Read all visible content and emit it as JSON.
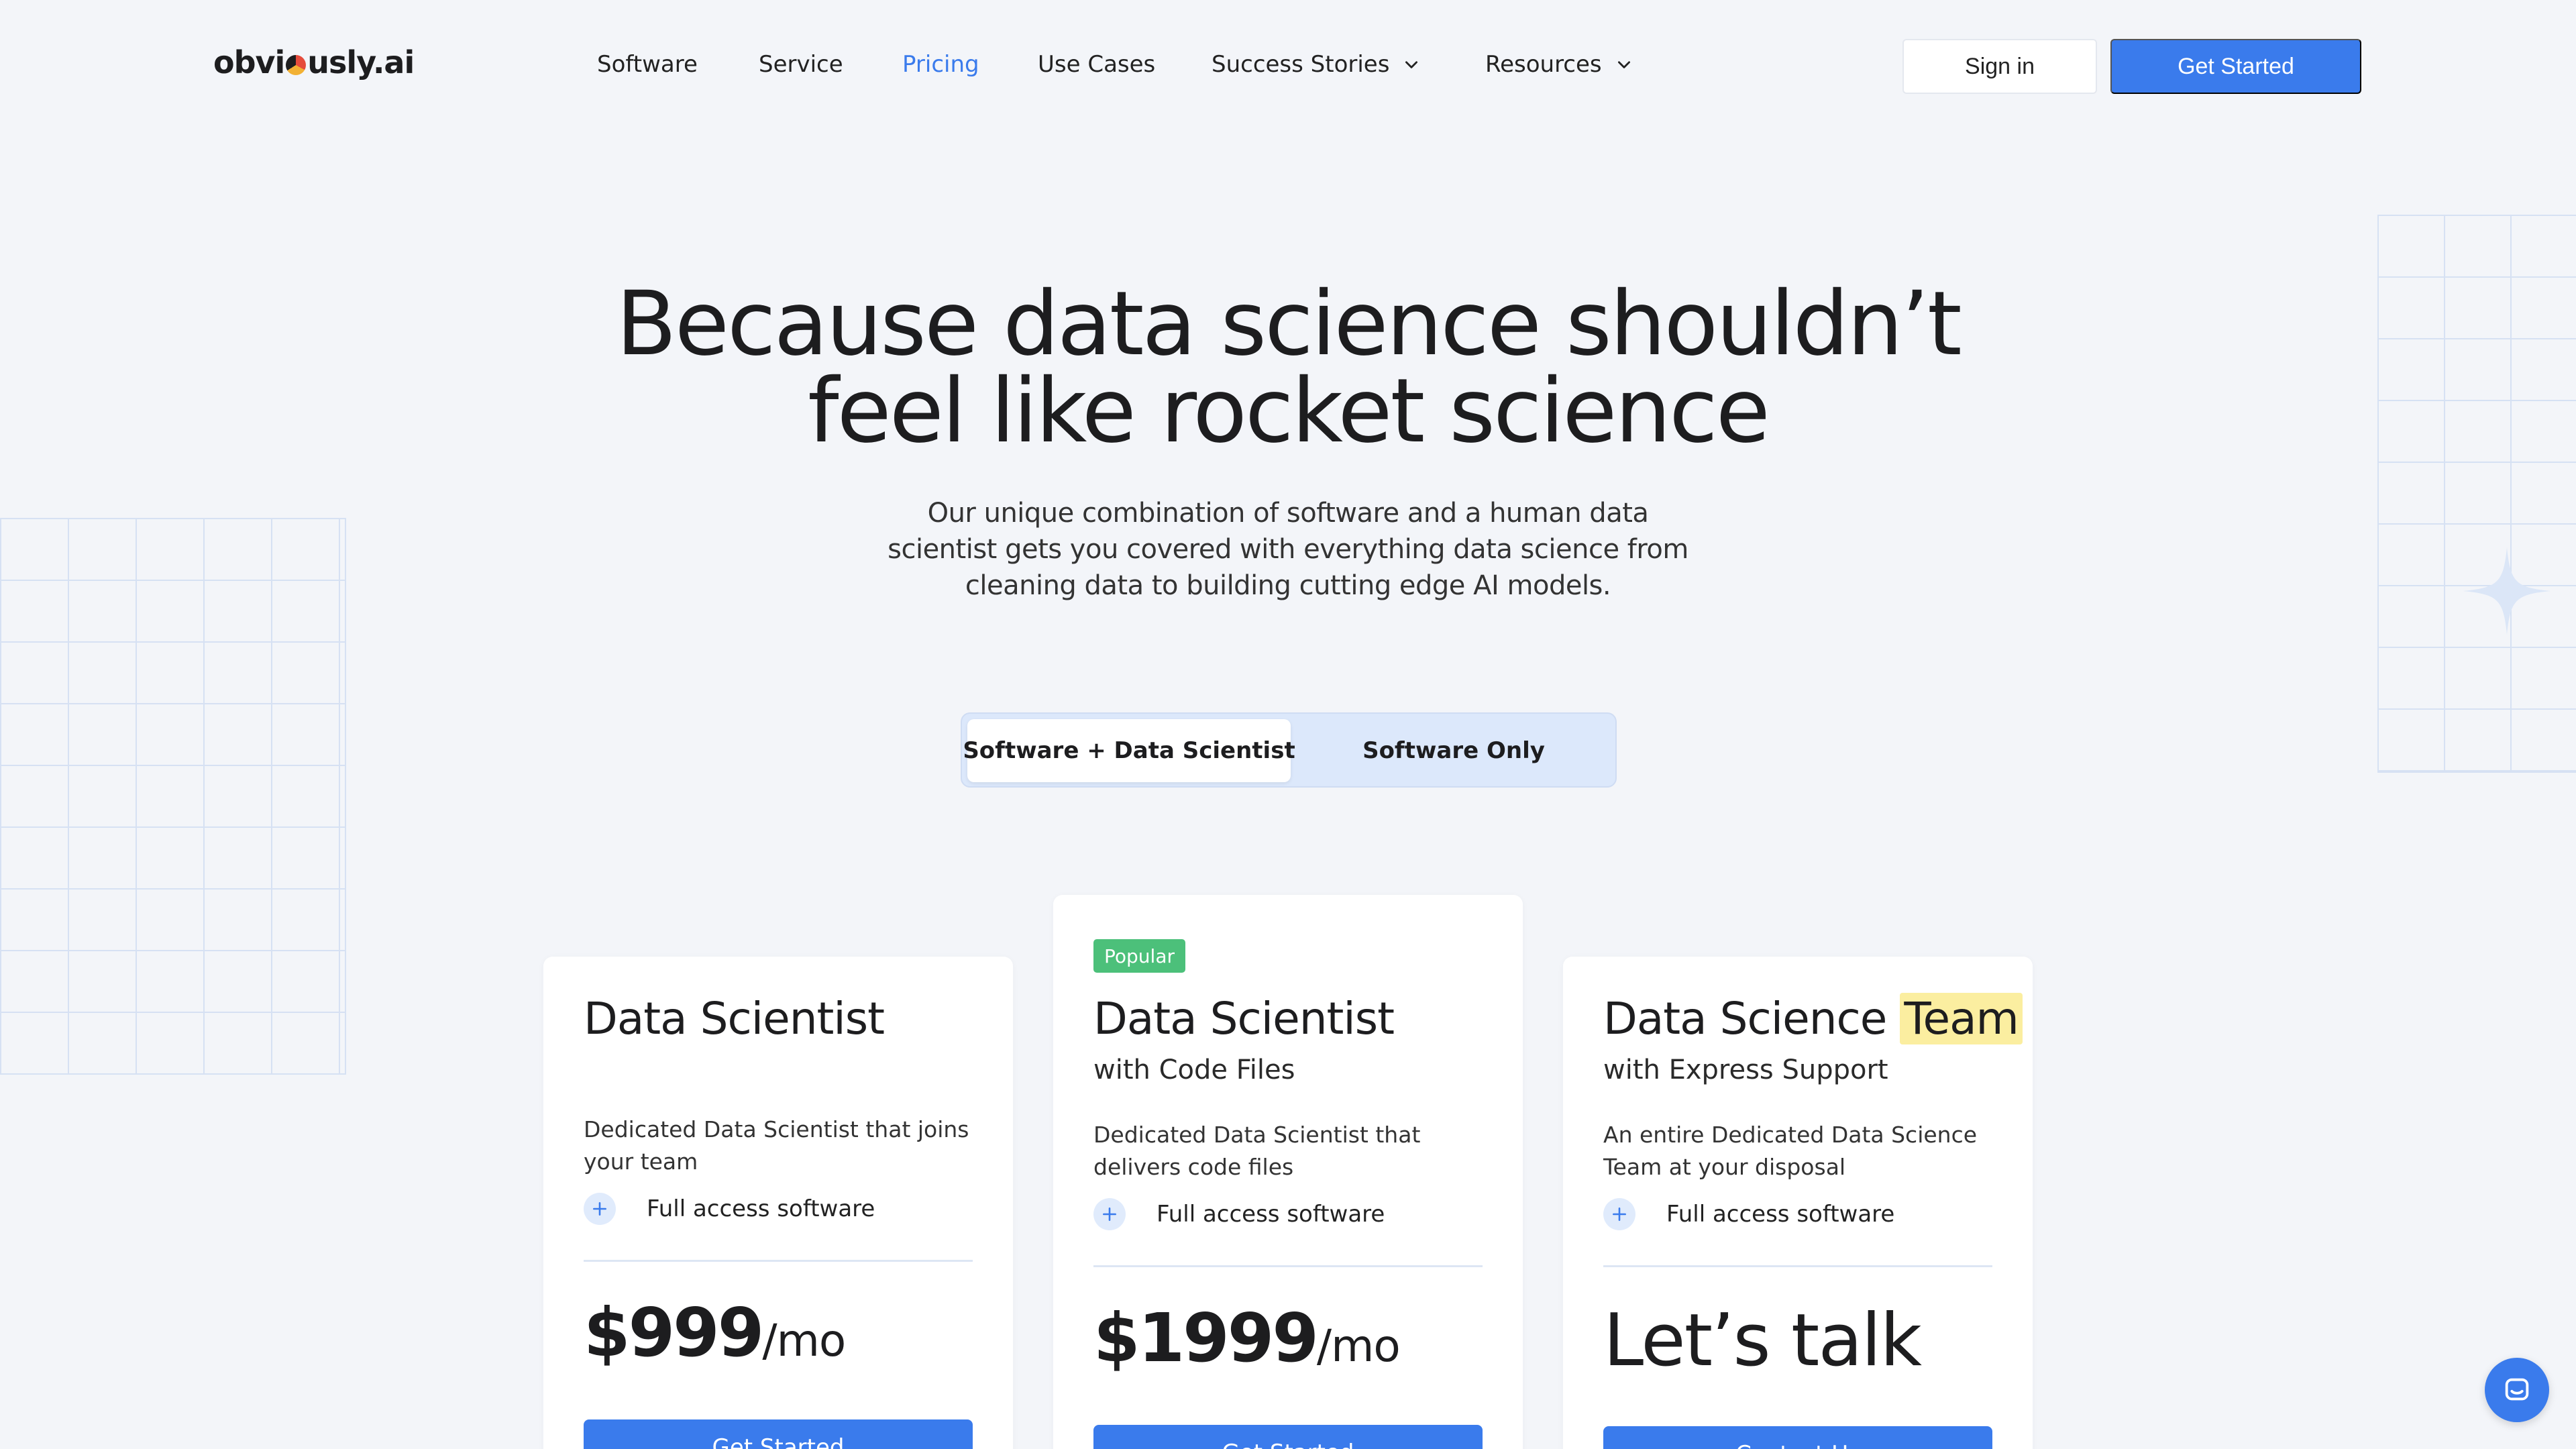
{
  "brand": {
    "logo_text_a": "obvi",
    "logo_text_b": "usly.ai"
  },
  "nav": {
    "links": [
      {
        "label": "Software"
      },
      {
        "label": "Service"
      },
      {
        "label": "Pricing"
      },
      {
        "label": "Use Cases"
      },
      {
        "label": "Success Stories"
      },
      {
        "label": "Resources"
      }
    ],
    "sign_in": "Sign in",
    "get_started": "Get Started"
  },
  "hero": {
    "title_line1": "Because data science shouldn’t",
    "title_line2": "feel like rocket science",
    "subtitle": "Our unique combination of software and a human data scientist gets you covered with everything data science from cleaning data to building cutting edge AI models."
  },
  "toggle": {
    "option_selected": "Software + Data Scientist",
    "option_other": "Software Only"
  },
  "plans": [
    {
      "title": "Data Scientist",
      "subtitle": "",
      "description": "Dedicated Data Scientist that joins your team",
      "feature": "Full access software",
      "price": "$999",
      "period": "/mo",
      "cta": "Get Started"
    },
    {
      "badge": "Popular",
      "title": "Data Scientist",
      "subtitle": "with Code Files",
      "description": "Dedicated Data Scientist that delivers code files",
      "feature": "Full access software",
      "price": "$1999",
      "period": "/mo",
      "cta": "Get Started"
    },
    {
      "title_a": "Data Science ",
      "title_highlight": "Team",
      "subtitle": "with Express Support",
      "description": "An entire Dedicated Data Science Team at your disposal",
      "feature": "Full access software",
      "price": "Let’s talk",
      "cta": "Contact Us"
    }
  ],
  "colors": {
    "accent": "#3a7bec",
    "badge": "#4cc07a",
    "highlight": "#fbeea0",
    "background": "#f3f5f9"
  },
  "icons": {
    "chat": "chat-icon",
    "plus": "plus-icon",
    "chevron": "chevron-down-icon"
  }
}
